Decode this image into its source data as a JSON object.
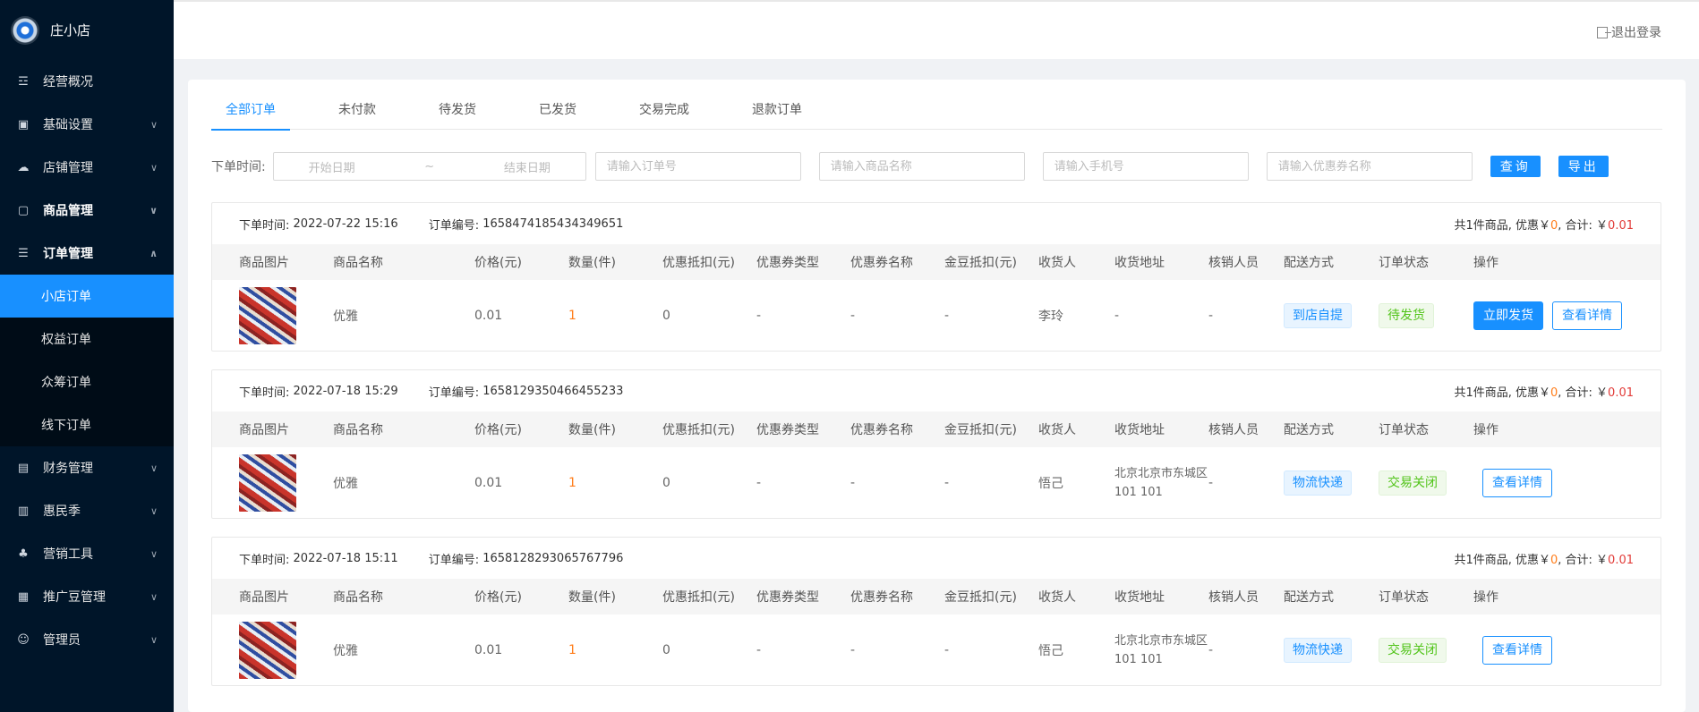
{
  "brand": {
    "name": "庄小店"
  },
  "sidebar": {
    "items": [
      {
        "label": "经营概况",
        "icon": "chart-icon",
        "chevron": false
      },
      {
        "label": "基础设置",
        "icon": "box-icon",
        "chevron": true
      },
      {
        "label": "店铺管理",
        "icon": "cloud-icon",
        "chevron": true
      },
      {
        "label": "商品管理",
        "icon": "bag-icon",
        "chevron": true,
        "bold": true
      },
      {
        "label": "订单管理",
        "icon": "document-icon",
        "chevron": true,
        "expanded": true,
        "bold": true
      },
      {
        "label": "财务管理",
        "icon": "wallet-icon",
        "chevron": true
      },
      {
        "label": "惠民季",
        "icon": "gift-icon",
        "chevron": true
      },
      {
        "label": "营销工具",
        "icon": "tools-icon",
        "chevron": true
      },
      {
        "label": "推广豆管理",
        "icon": "list-icon",
        "chevron": true
      },
      {
        "label": "管理员",
        "icon": "user-icon",
        "chevron": true
      }
    ],
    "submenu": [
      {
        "label": "小店订单",
        "active": true
      },
      {
        "label": "权益订单"
      },
      {
        "label": "众筹订单"
      },
      {
        "label": "线下订单"
      }
    ]
  },
  "header": {
    "logout": "退出登录"
  },
  "tabs": [
    "全部订单",
    "未付款",
    "待发货",
    "已发货",
    "交易完成",
    "退款订单"
  ],
  "filters": {
    "label": "下单时间:",
    "start_placeholder": "开始日期",
    "separator": "~",
    "end_placeholder": "结束日期",
    "order_no_placeholder": "请输入订单号",
    "product_placeholder": "请输入商品名称",
    "phone_placeholder": "请输入手机号",
    "coupon_placeholder": "请输入优惠券名称",
    "query_label": "查询",
    "export_label": "导出"
  },
  "table_headers": [
    "商品图片",
    "商品名称",
    "价格(元)",
    "数量(件)",
    "优惠抵扣(元)",
    "优惠券类型",
    "优惠券名称",
    "金豆抵扣(元)",
    "收货人",
    "收货地址",
    "核销人员",
    "配送方式",
    "订单状态",
    "操作"
  ],
  "orders": [
    {
      "time_label": "下单时间:",
      "time": "2022-07-22 15:16",
      "no_label": "订单编号:",
      "no": "1658474185434349651",
      "summary_prefix": "共1件商品, 优惠￥",
      "discount": "0",
      "summary_mid": ", 合计: ￥",
      "total": "0.01",
      "row": {
        "name": "优雅",
        "price": "0.01",
        "qty": "1",
        "deduct": "0",
        "coupon_type": "-",
        "coupon_name": "-",
        "bean": "-",
        "receiver": "李玲",
        "address": "-",
        "verifier": "-",
        "delivery": "到店自提",
        "status": "待发货",
        "primary_action": "立即发货",
        "detail_action": "查看详情"
      }
    },
    {
      "time_label": "下单时间:",
      "time": "2022-07-18 15:29",
      "no_label": "订单编号:",
      "no": "1658129350466455233",
      "summary_prefix": "共1件商品, 优惠￥",
      "discount": "0",
      "summary_mid": ", 合计: ￥",
      "total": "0.01",
      "row": {
        "name": "优雅",
        "price": "0.01",
        "qty": "1",
        "deduct": "0",
        "coupon_type": "-",
        "coupon_name": "-",
        "bean": "-",
        "receiver": "悟己",
        "address": "北京北京市东城区101 101",
        "verifier": "-",
        "delivery": "物流快递",
        "status": "交易关闭",
        "detail_action": "查看详情"
      }
    },
    {
      "time_label": "下单时间:",
      "time": "2022-07-18 15:11",
      "no_label": "订单编号:",
      "no": "1658128293065767796",
      "summary_prefix": "共1件商品, 优惠￥",
      "discount": "0",
      "summary_mid": ", 合计: ￥",
      "total": "0.01",
      "row": {
        "name": "优雅",
        "price": "0.01",
        "qty": "1",
        "deduct": "0",
        "coupon_type": "-",
        "coupon_name": "-",
        "bean": "-",
        "receiver": "悟己",
        "address": "北京北京市东城区101 101",
        "verifier": "-",
        "delivery": "物流快递",
        "status": "交易关闭",
        "detail_action": "查看详情"
      }
    }
  ],
  "colors": {
    "sidebar_bg": "#001529",
    "accent": "#1890ff",
    "orange": "#ff7d1a",
    "red": "#e23c39",
    "green": "#52c41a"
  }
}
